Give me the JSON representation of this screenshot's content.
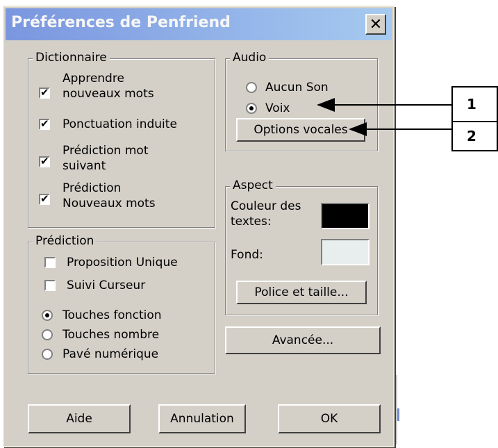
{
  "window": {
    "title": "Préférences de Penfriend",
    "close_glyph": "✕"
  },
  "dictionnaire": {
    "legend": "Dictionnaire",
    "items": [
      {
        "line1": "Apprendre",
        "line2": "nouveaux mots",
        "checked": true
      },
      {
        "line1": "Ponctuation induite",
        "line2": "",
        "checked": true
      },
      {
        "line1": "Prédiction mot",
        "line2": "suivant",
        "checked": true
      },
      {
        "line1": "Prédiction",
        "line2": "Nouveaux mots",
        "checked": true
      }
    ]
  },
  "prediction": {
    "legend": "Prédiction",
    "checks": [
      {
        "label": "Proposition Unique",
        "checked": false
      },
      {
        "label": "Suivi Curseur",
        "checked": false
      }
    ],
    "radios": [
      {
        "label": "Touches fonction",
        "selected": true
      },
      {
        "label": "Touches nombre",
        "selected": false
      },
      {
        "label": "Pavé numérique",
        "selected": false
      }
    ]
  },
  "audio": {
    "legend": "Audio",
    "radios": [
      {
        "label": "Aucun Son",
        "selected": false
      },
      {
        "label": "Voix",
        "selected": true
      }
    ],
    "options_button": "Options vocales"
  },
  "aspect": {
    "legend": "Aspect",
    "text_color_line1": "Couleur des",
    "text_color_line2": "textes:",
    "text_color_value": "#000000",
    "background_label": "Fond:",
    "background_value": "#e8eeee",
    "font_button": "Police et taille..."
  },
  "advanced_button": "Avancée...",
  "footer": {
    "help": "Aide",
    "cancel": "Annulation",
    "ok": "OK"
  },
  "callouts": [
    "1",
    "2"
  ],
  "check_glyph": "✔"
}
